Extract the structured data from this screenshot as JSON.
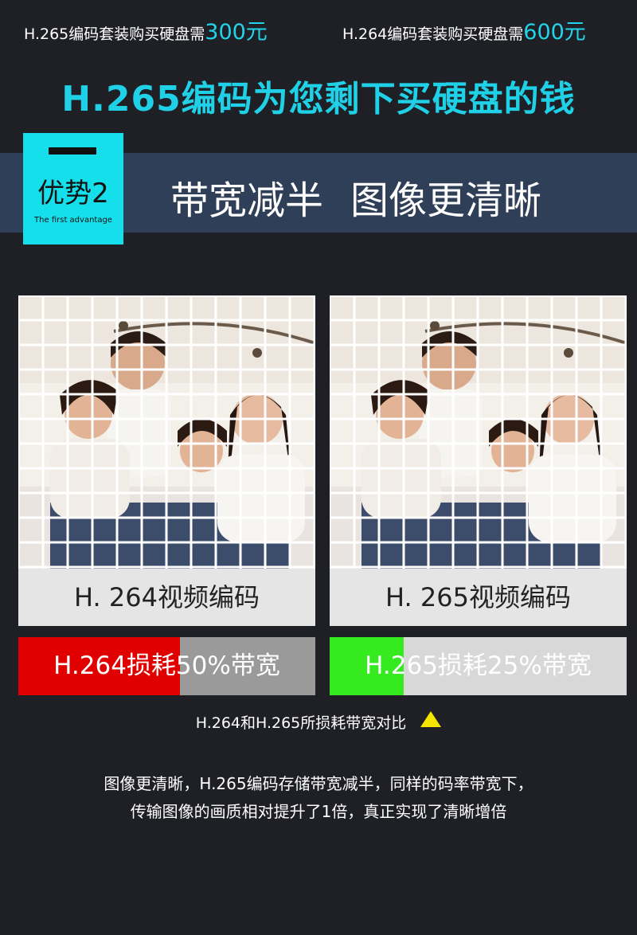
{
  "top": {
    "left_text": "H.265编码套装购买硬盘需",
    "left_amount": "300元",
    "right_text": "H.264编码套装购买硬盘需",
    "right_amount": "600元"
  },
  "headline": "H.265编码为您剩下买硬盘的钱",
  "advantage": {
    "badge_title": "优势2",
    "badge_subtitle": "The first advantage",
    "text_1": "带宽减半",
    "text_2": "图像更清晰"
  },
  "panels": [
    {
      "caption": "H. 264视频编码",
      "bandwidth_label": "H.264损耗50%带宽",
      "loss_fraction": 0.5,
      "fill_color": "#e00000"
    },
    {
      "caption": "H. 265视频编码",
      "bandwidth_label": "H.265损耗25%带宽",
      "loss_fraction": 0.25,
      "fill_color": "#35ea1e"
    }
  ],
  "compare_note": "H.264和H.265所损耗带宽对比",
  "description": {
    "line_1": "图像更清晰，H.265编码存储带宽减半，同样的码率带宽下，",
    "line_2": "传输图像的画质相对提升了1倍，真正实现了清晰增倍"
  },
  "colors": {
    "accent": "#1fd0e6",
    "banner_bg": "#2f3f57",
    "page_bg": "#1f2025"
  }
}
